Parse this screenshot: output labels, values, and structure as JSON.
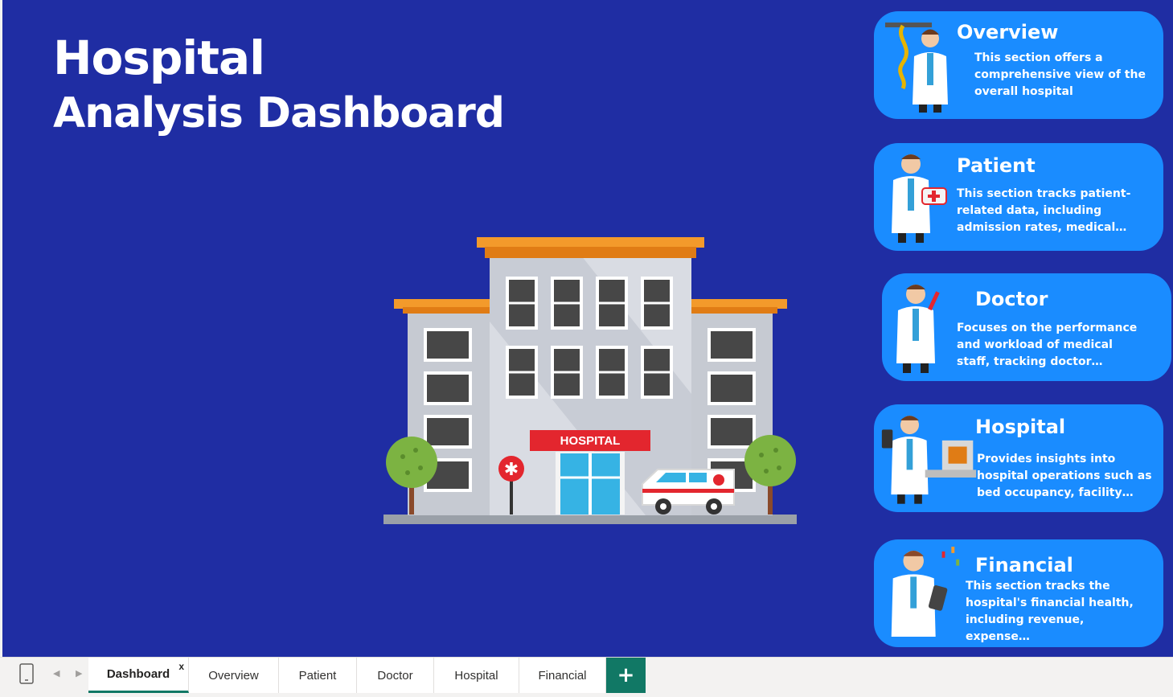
{
  "dashboard": {
    "title_line1": "Hospital",
    "title_line2": "Analysis Dashboard",
    "building_sign": "HOSPITAL",
    "background_color": "#1f2da3",
    "card_color": "#1a8cff"
  },
  "cards": [
    {
      "title": "Overview",
      "description": "This section offers a comprehensive view of the overall hospital",
      "icon": "doctor-caduceus-icon"
    },
    {
      "title": "Patient",
      "description": "This section tracks patient-related data, including admission rates, medical…",
      "icon": "doctor-first-aid-icon"
    },
    {
      "title": "Doctor",
      "description": "Focuses on the performance and workload of medical staff, tracking doctor…",
      "icon": "doctor-syringe-icon"
    },
    {
      "title": "Hospital",
      "description": "Provides insights into hospital operations such as bed occupancy, facility…",
      "icon": "doctor-hospital-bed-icon"
    },
    {
      "title": "Financial",
      "description": "This section tracks the hospital's financial health, including revenue, expense…",
      "icon": "doctor-clipboard-icon"
    }
  ],
  "tabs": [
    {
      "label": "Dashboard",
      "active": true
    },
    {
      "label": "Overview"
    },
    {
      "label": "Patient"
    },
    {
      "label": "Doctor"
    },
    {
      "label": "Hospital"
    },
    {
      "label": "Financial"
    }
  ],
  "tab_close_label": "x",
  "add_tab_label": "+",
  "accent_color": "#117865"
}
